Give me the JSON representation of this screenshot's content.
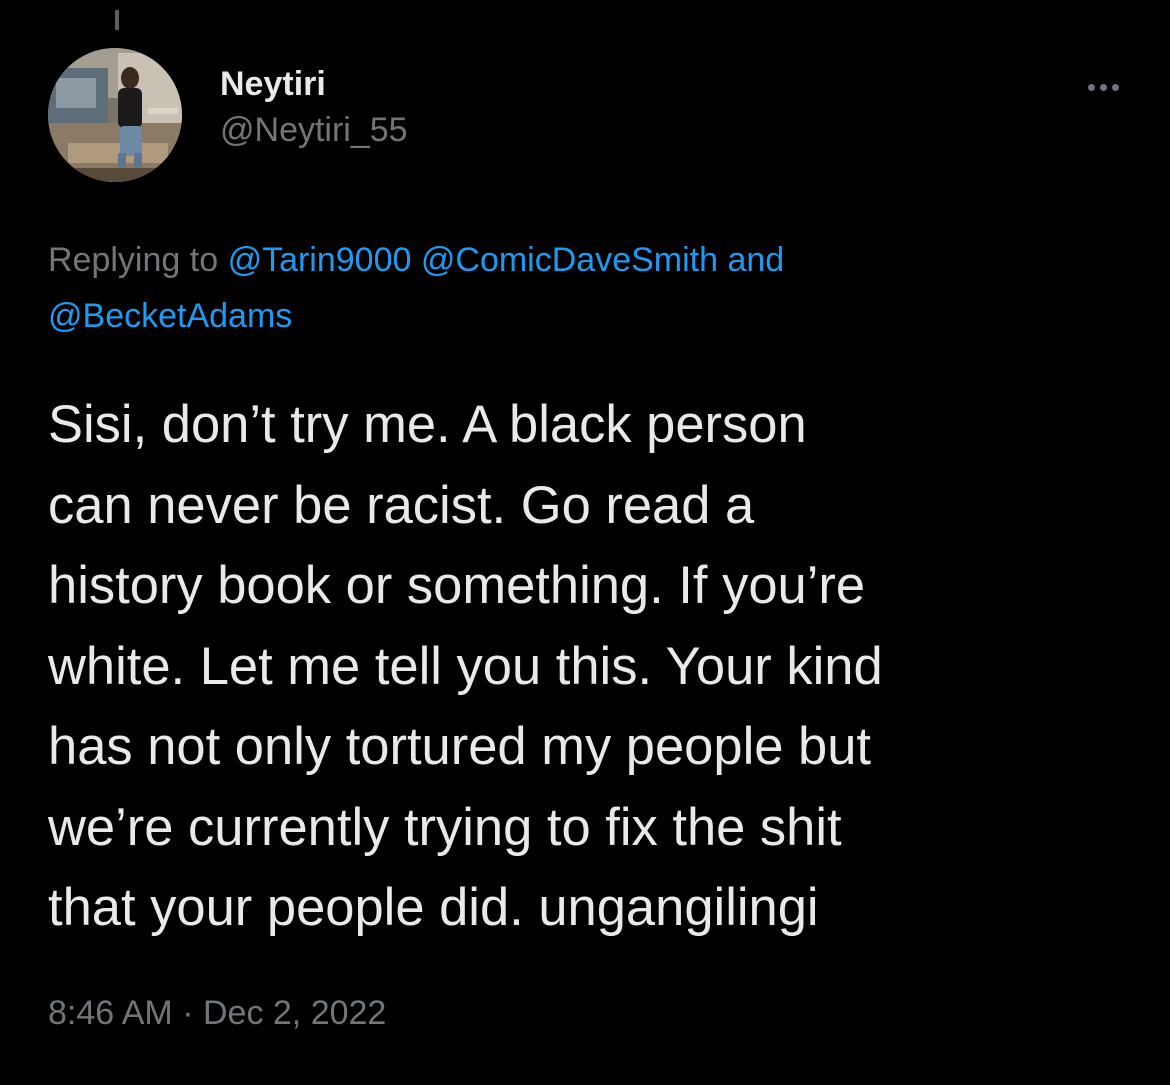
{
  "tweet": {
    "author": {
      "display_name": "Neytiri",
      "handle": "@Neytiri_55",
      "avatar_icon": "profile-photo"
    },
    "more_icon": "ellipsis-icon",
    "reply_context": {
      "prefix": "Replying to",
      "mentions": [
        "@Tarin9000",
        "@ComicDaveSmith"
      ],
      "joiner": "and",
      "last_mention": "@BecketAdams"
    },
    "text_lines": [
      "Sisi, don’t try me. A black person",
      "can never be racist. Go read a",
      "history book or something. If you’re",
      "white. Let me tell you this. Your kind",
      "has not only tortured my people but",
      "we’re currently trying to fix the shit",
      "that your people did. ungangilingi"
    ],
    "time": "8:46 AM",
    "separator": "·",
    "date": "Dec 2, 2022"
  },
  "colors": {
    "background": "#000000",
    "primary_text": "#e7e9ea",
    "secondary_text": "#71767b",
    "link": "#1d9bf0"
  }
}
